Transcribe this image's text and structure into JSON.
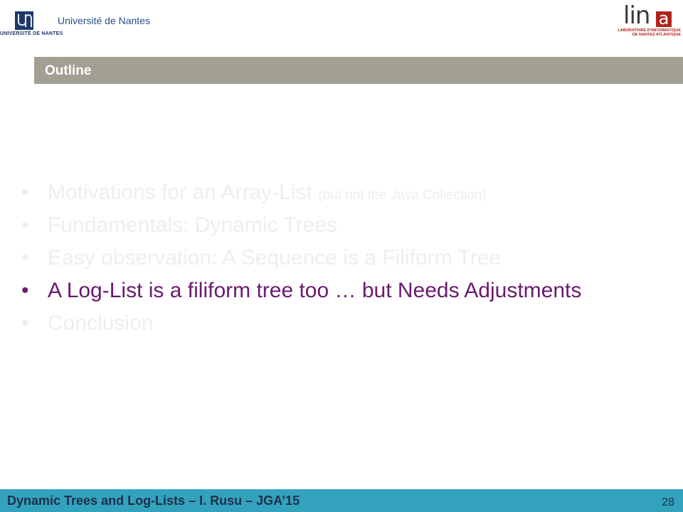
{
  "header": {
    "university_name": "Université de Nantes",
    "university_logo_caption": "UNIVERSITÉ DE NANTES",
    "lab_logo": {
      "word": "lin",
      "letter": "a",
      "subtitle_line1": "LABORATOIRE D'INFORMATIQUE",
      "subtitle_line2": "DE NANTES ATLANTIQUE"
    }
  },
  "slide": {
    "title": "Outline",
    "outline": [
      {
        "bullet": "•",
        "text": "Motivations for an Array-List ",
        "note": "(but not the Java Collection)",
        "active": false
      },
      {
        "bullet": "•",
        "text": "Fundamentals: Dynamic Trees",
        "note": "",
        "active": false
      },
      {
        "bullet": "•",
        "text": "Easy observation: A Sequence is a Filiform Tree",
        "note": "",
        "active": false
      },
      {
        "bullet": "•",
        "text": "A Log-List is a filiform tree too … but Needs Adjustments",
        "note": "",
        "active": true
      },
      {
        "bullet": "•",
        "text": "Conclusion",
        "note": "",
        "active": false
      }
    ]
  },
  "footer": {
    "text": "Dynamic Trees and Log-Lists – I. Rusu – JGA’15",
    "page_number": "28"
  },
  "colors": {
    "title_bar": "#a29f93",
    "footer_bar": "#33a2bd",
    "active_item": "#6a1a6e",
    "inactive_item": "#eeeeee",
    "lab_red": "#b1241d",
    "university_blue": "#1f3a67"
  }
}
